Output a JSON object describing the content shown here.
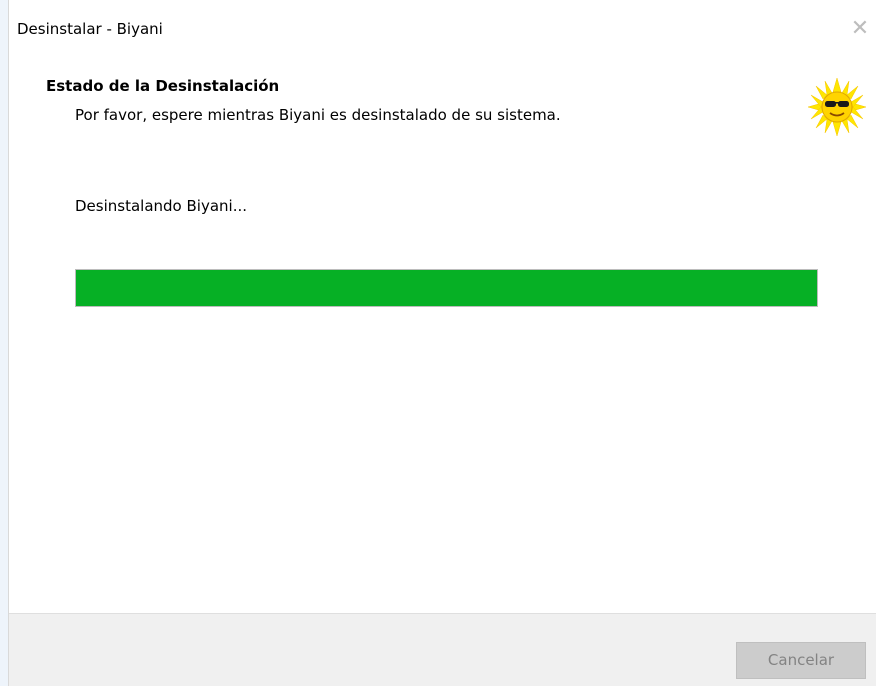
{
  "window": {
    "title": "Desinstalar - Biyani",
    "close_glyph": "✕"
  },
  "header": {
    "title": "Estado de la Desinstalación",
    "subtitle": "Por favor, espere mientras Biyani es desinstalado de su sistema.",
    "logo_icon": "sun-with-sunglasses-icon"
  },
  "main": {
    "status_text": "Desinstalando Biyani...",
    "progress_percent": 100,
    "progress_color": "#06b025"
  },
  "footer": {
    "cancel_label": "Cancelar",
    "cancel_enabled": false
  }
}
